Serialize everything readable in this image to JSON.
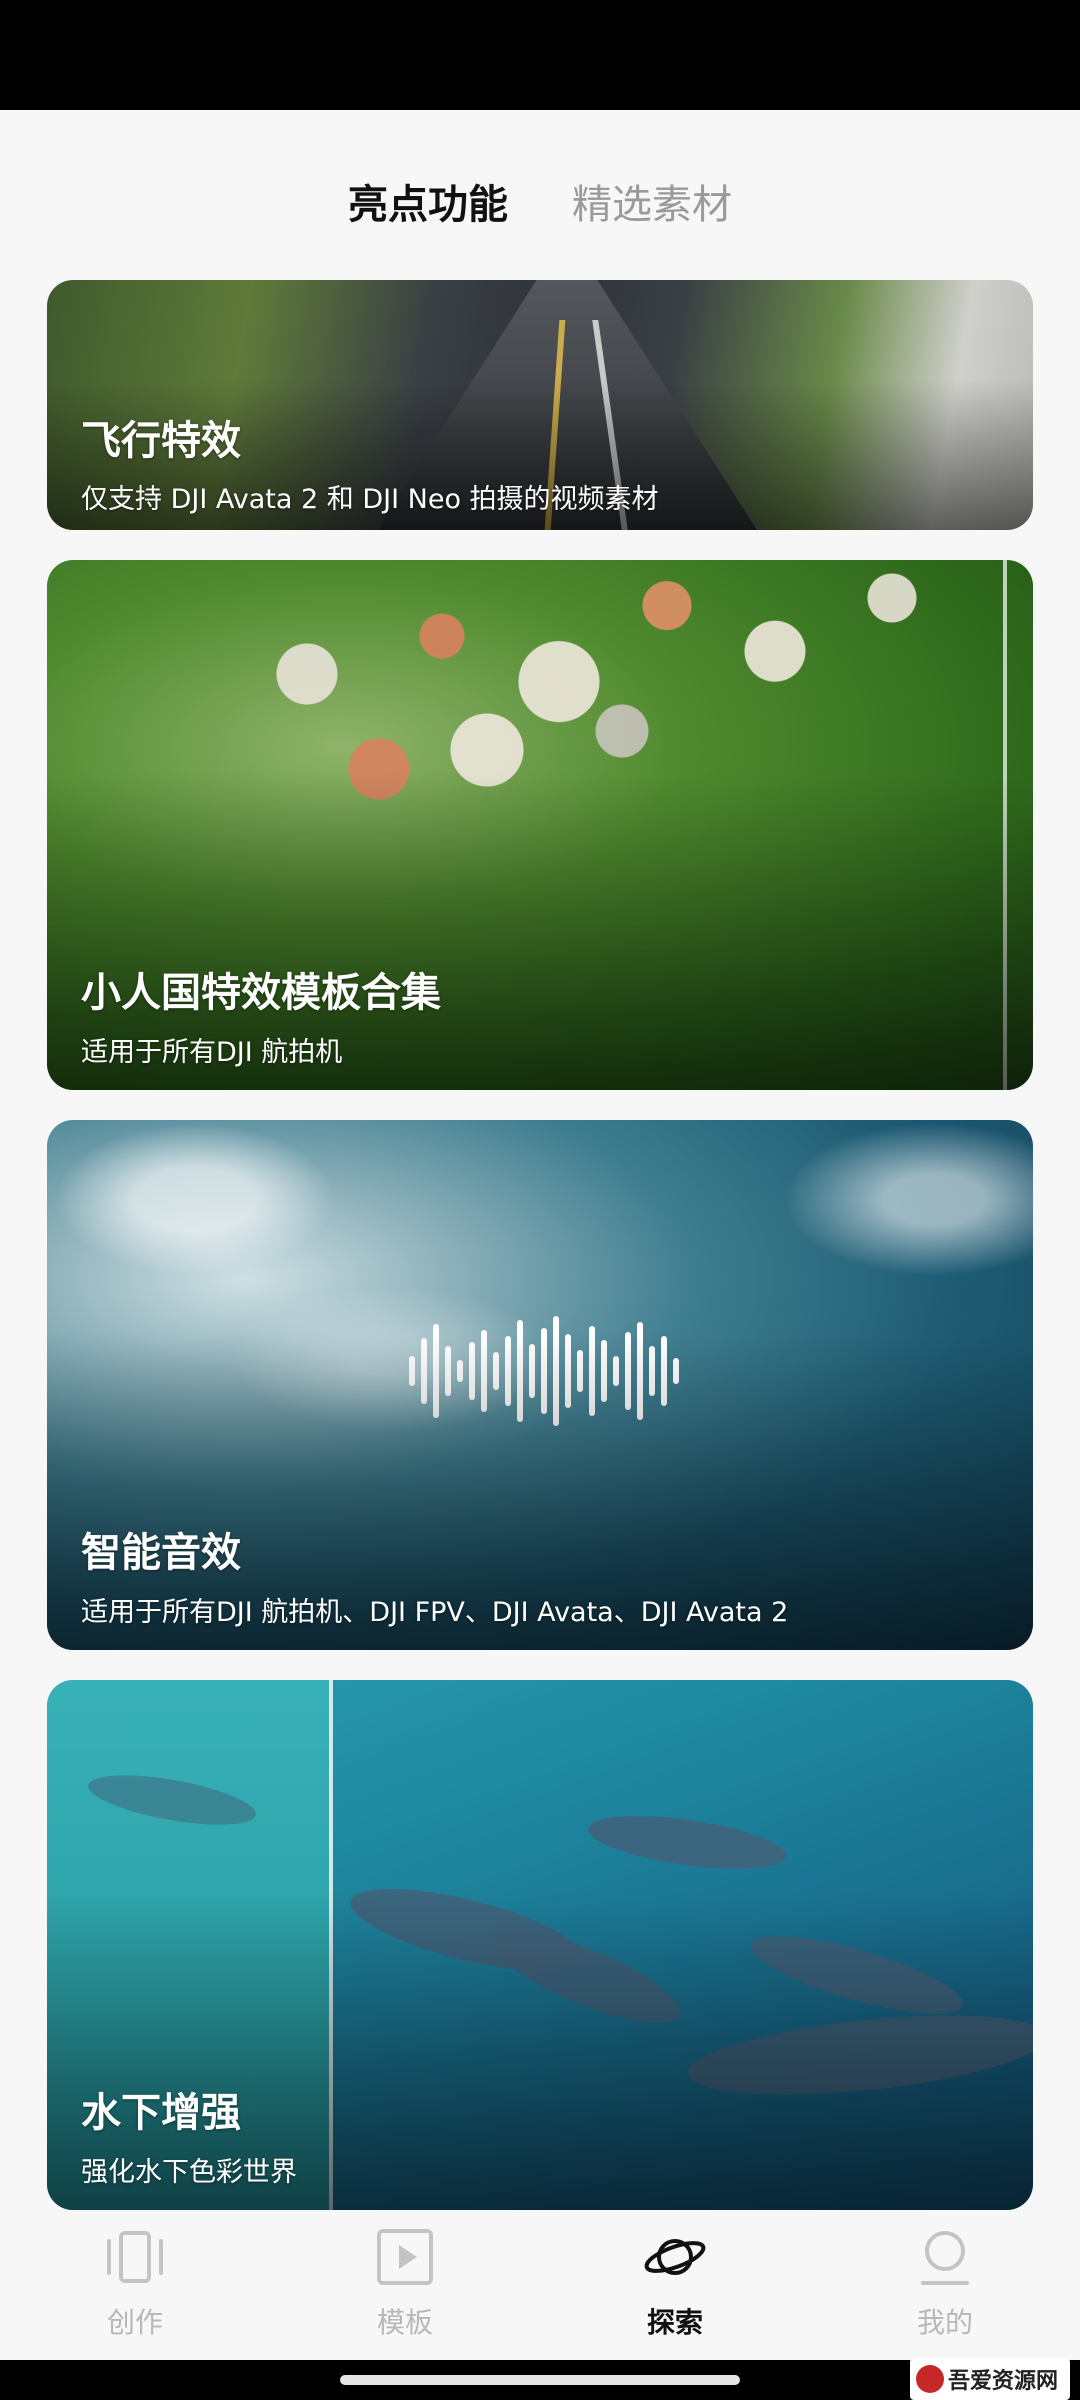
{
  "tabs": [
    {
      "label": "亮点功能",
      "active": true
    },
    {
      "label": "精选素材",
      "active": false
    }
  ],
  "cards": [
    {
      "title": "飞行特效",
      "subtitle": "仅支持 DJI Avata 2 和 DJI Neo 拍摄的视频素材"
    },
    {
      "title": "小人国特效模板合集",
      "subtitle": "适用于所有DJI 航拍机"
    },
    {
      "title": "智能音效",
      "subtitle": "适用于所有DJI 航拍机、DJI FPV、DJI Avata、DJI Avata 2"
    },
    {
      "title": "水下增强",
      "subtitle": "强化水下色彩世界"
    }
  ],
  "bottom_nav": [
    {
      "label": "创作",
      "icon": "phone-frame-icon",
      "active": false
    },
    {
      "label": "模板",
      "icon": "play-template-icon",
      "active": false
    },
    {
      "label": "探索",
      "icon": "planet-icon",
      "active": true
    },
    {
      "label": "我的",
      "icon": "user-icon",
      "active": false
    }
  ],
  "watermark": {
    "text": "吾爱资源网"
  },
  "colors": {
    "background": "#f7f7f7",
    "active_text": "#111111",
    "inactive_text": "#9a9a9a",
    "nav_inactive": "#b8b8b8"
  }
}
